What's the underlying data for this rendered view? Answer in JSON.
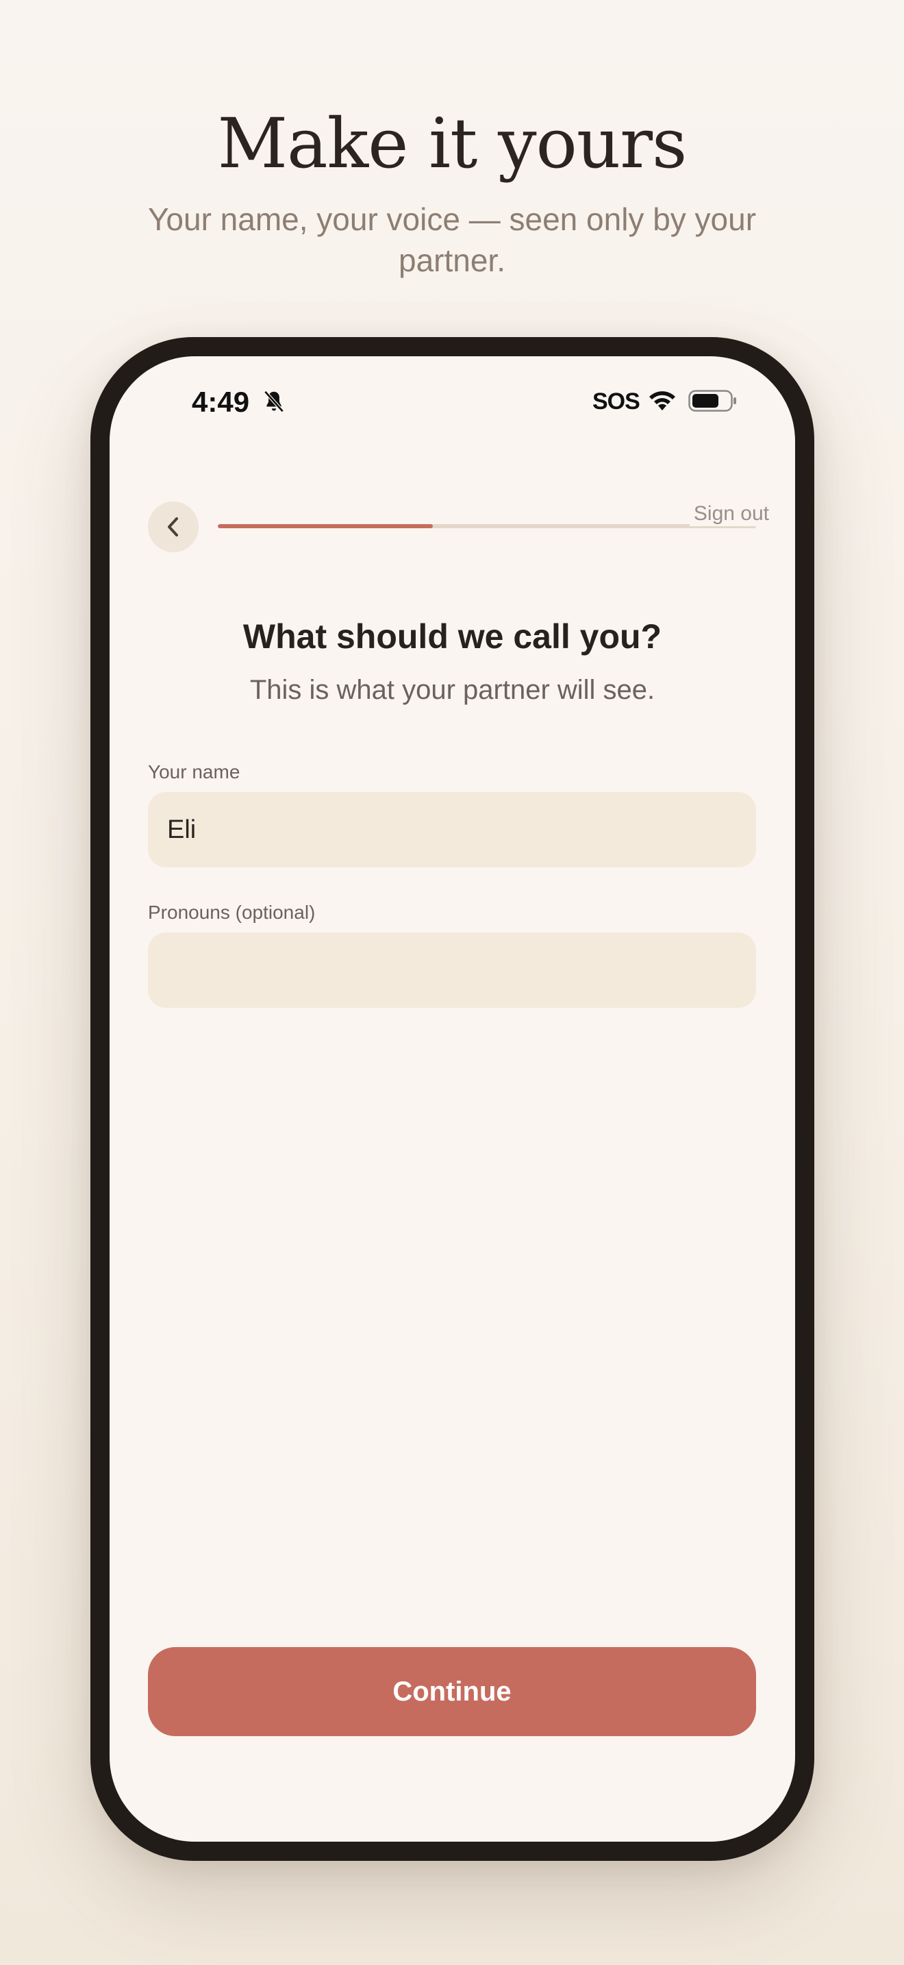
{
  "hero": {
    "title": "Make it yours",
    "subtitle": "Your name, your voice — seen only by your partner."
  },
  "status_bar": {
    "time": "4:49",
    "carrier_text": "SOS",
    "icons": [
      "bell-off-icon",
      "wifi-icon",
      "battery-icon"
    ]
  },
  "nav": {
    "back_icon": "chevron-left-icon",
    "sign_out_label": "Sign out",
    "progress_fraction": 0.4
  },
  "screen": {
    "title": "What should we call you?",
    "subtitle": "This is what your partner will see."
  },
  "form": {
    "name_label": "Your name",
    "name_value": "Eli",
    "pronouns_label": "Pronouns (optional)",
    "pronouns_value": ""
  },
  "actions": {
    "continue_label": "Continue"
  },
  "colors": {
    "accent": "#c66c5f",
    "field_bg": "#f4eadc",
    "screen_bg": "#faf5f0",
    "frame": "#211c18"
  }
}
